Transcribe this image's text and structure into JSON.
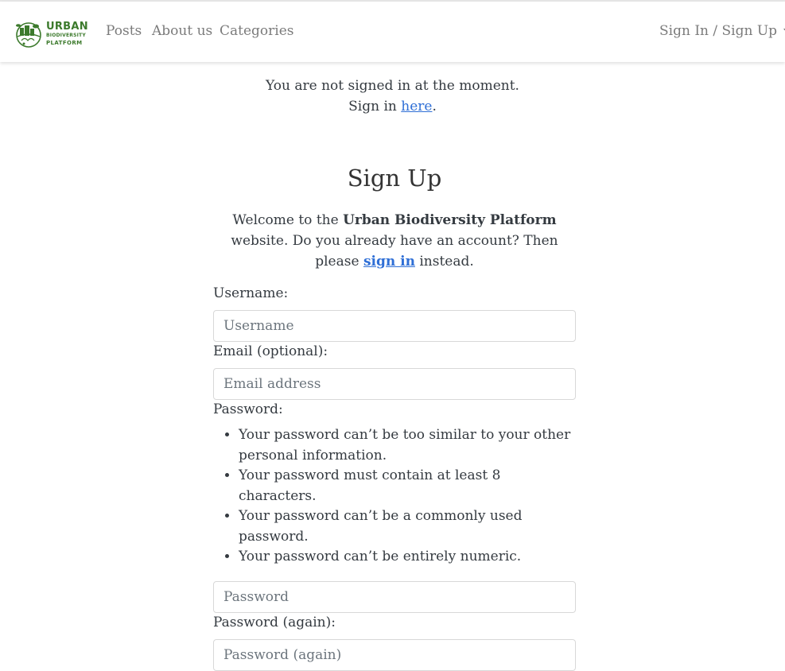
{
  "brand": {
    "logo_line1": "URBAN",
    "logo_line2": "BIODIVERSITY",
    "logo_line3": "PLATFORM",
    "color": "#3c7a2c"
  },
  "nav": {
    "posts": "Posts",
    "about": "About us",
    "categories": "Categories",
    "sign": "Sign In / Sign Up"
  },
  "notice": {
    "line1": "You are not signed in at the moment.",
    "line2_prefix": "Sign in ",
    "line2_link": "here",
    "line2_suffix": "."
  },
  "signup": {
    "title": "Sign Up",
    "intro_prefix": "Welcome to the ",
    "intro_bold": "Urban Biodiversity Platform",
    "intro_mid": " website. Do you already have an account? Then please ",
    "intro_link": "sign in",
    "intro_suffix": " instead.",
    "username_label": "Username:",
    "username_placeholder": "Username",
    "email_label": "Email (optional):",
    "email_placeholder": "Email address",
    "password_label": "Password:",
    "password_rules": [
      "Your password can’t be too similar to your other personal information.",
      "Your password must contain at least 8 characters.",
      "Your password can’t be a commonly used password.",
      "Your password can’t be entirely numeric."
    ],
    "password_placeholder": "Password",
    "password2_label": "Password (again):",
    "password2_placeholder": "Password (again)"
  },
  "colors": {
    "link": "#2f6fd6",
    "nav_text": "#7b7b7b",
    "body_text": "#343a40"
  }
}
